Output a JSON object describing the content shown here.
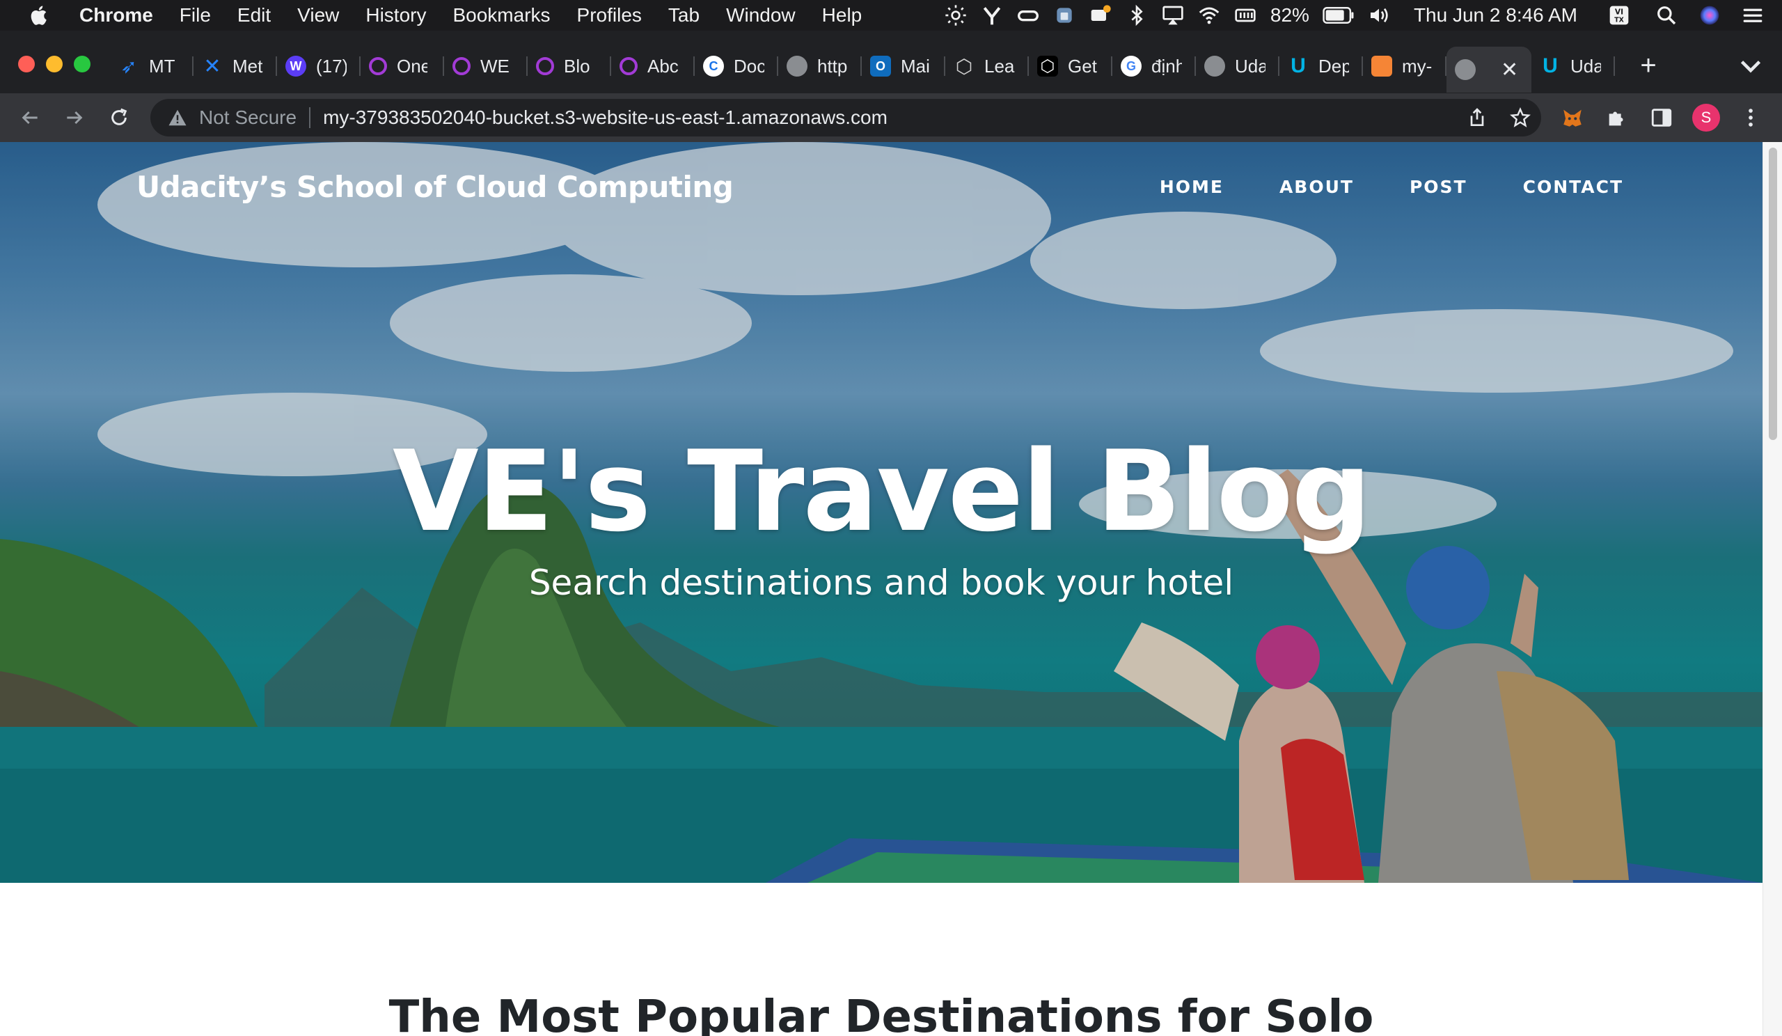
{
  "menubar": {
    "app_name": "Chrome",
    "items": [
      "File",
      "Edit",
      "View",
      "History",
      "Bookmarks",
      "Profiles",
      "Tab",
      "Window",
      "Help"
    ],
    "battery": "82%",
    "datetime": "Thu Jun 2  8:46 AM",
    "input_source": "VI TX"
  },
  "tabs": [
    {
      "title": "MT",
      "icon": "jira-icon",
      "color": "#2684ff"
    },
    {
      "title": "Met",
      "icon": "confluence-icon",
      "color": "#2684ff"
    },
    {
      "title": "(17)",
      "icon": "w-icon",
      "color": "#5b3df5"
    },
    {
      "title": "One",
      "icon": "c-swirl-icon",
      "color": "#a23bd6"
    },
    {
      "title": "WE",
      "icon": "c-swirl-icon",
      "color": "#a23bd6"
    },
    {
      "title": "Blo",
      "icon": "c-swirl-icon",
      "color": "#a23bd6"
    },
    {
      "title": "Abc",
      "icon": "c-swirl-icon",
      "color": "#a23bd6"
    },
    {
      "title": "Doc",
      "icon": "circle-c-icon",
      "color": "#1a73e8"
    },
    {
      "title": "http",
      "icon": "globe-icon",
      "color": "#8a8d91"
    },
    {
      "title": "Mai",
      "icon": "outlook-icon",
      "color": "#0f6cbd"
    },
    {
      "title": "Lea",
      "icon": "unity-icon",
      "color": "#cfcfcf"
    },
    {
      "title": "Get",
      "icon": "unity-dark-icon",
      "color": "#000000"
    },
    {
      "title": "định",
      "icon": "google-icon",
      "color": "#4285f4"
    },
    {
      "title": "Uda",
      "icon": "globe-icon",
      "color": "#8a8d91"
    },
    {
      "title": "Dep",
      "icon": "udacity-icon",
      "color": "#02b3e4"
    },
    {
      "title": "my-",
      "icon": "aws-s3-icon",
      "color": "#f58536"
    }
  ],
  "active_tab": {
    "title": "",
    "icon": "globe-icon",
    "close": "✕"
  },
  "last_tab": {
    "title": "Uda",
    "icon": "udacity-icon",
    "color": "#02b3e4"
  },
  "new_tab": "+",
  "omnibox": {
    "security_label": "Not Secure",
    "url": "my-379383502040-bucket.s3-website-us-east-1.amazonaws.com"
  },
  "profile_initial": "S",
  "site": {
    "brand": "Udacity’s School of Cloud Computing",
    "nav": [
      "HOME",
      "ABOUT",
      "POST",
      "CONTACT"
    ],
    "hero_title": "VE's Travel Blog",
    "hero_subtitle": "Search destinations and book your hotel",
    "section_heading": "The Most Popular Destinations for Solo"
  },
  "colors": {
    "menubar_bg": "#1b1b1d",
    "tabstrip_bg": "#202124",
    "toolbar_bg": "#35363a",
    "heading_text": "#212529",
    "close_red": "#ff5f57",
    "minimize_yellow": "#febc2e",
    "zoom_green": "#28c840"
  }
}
